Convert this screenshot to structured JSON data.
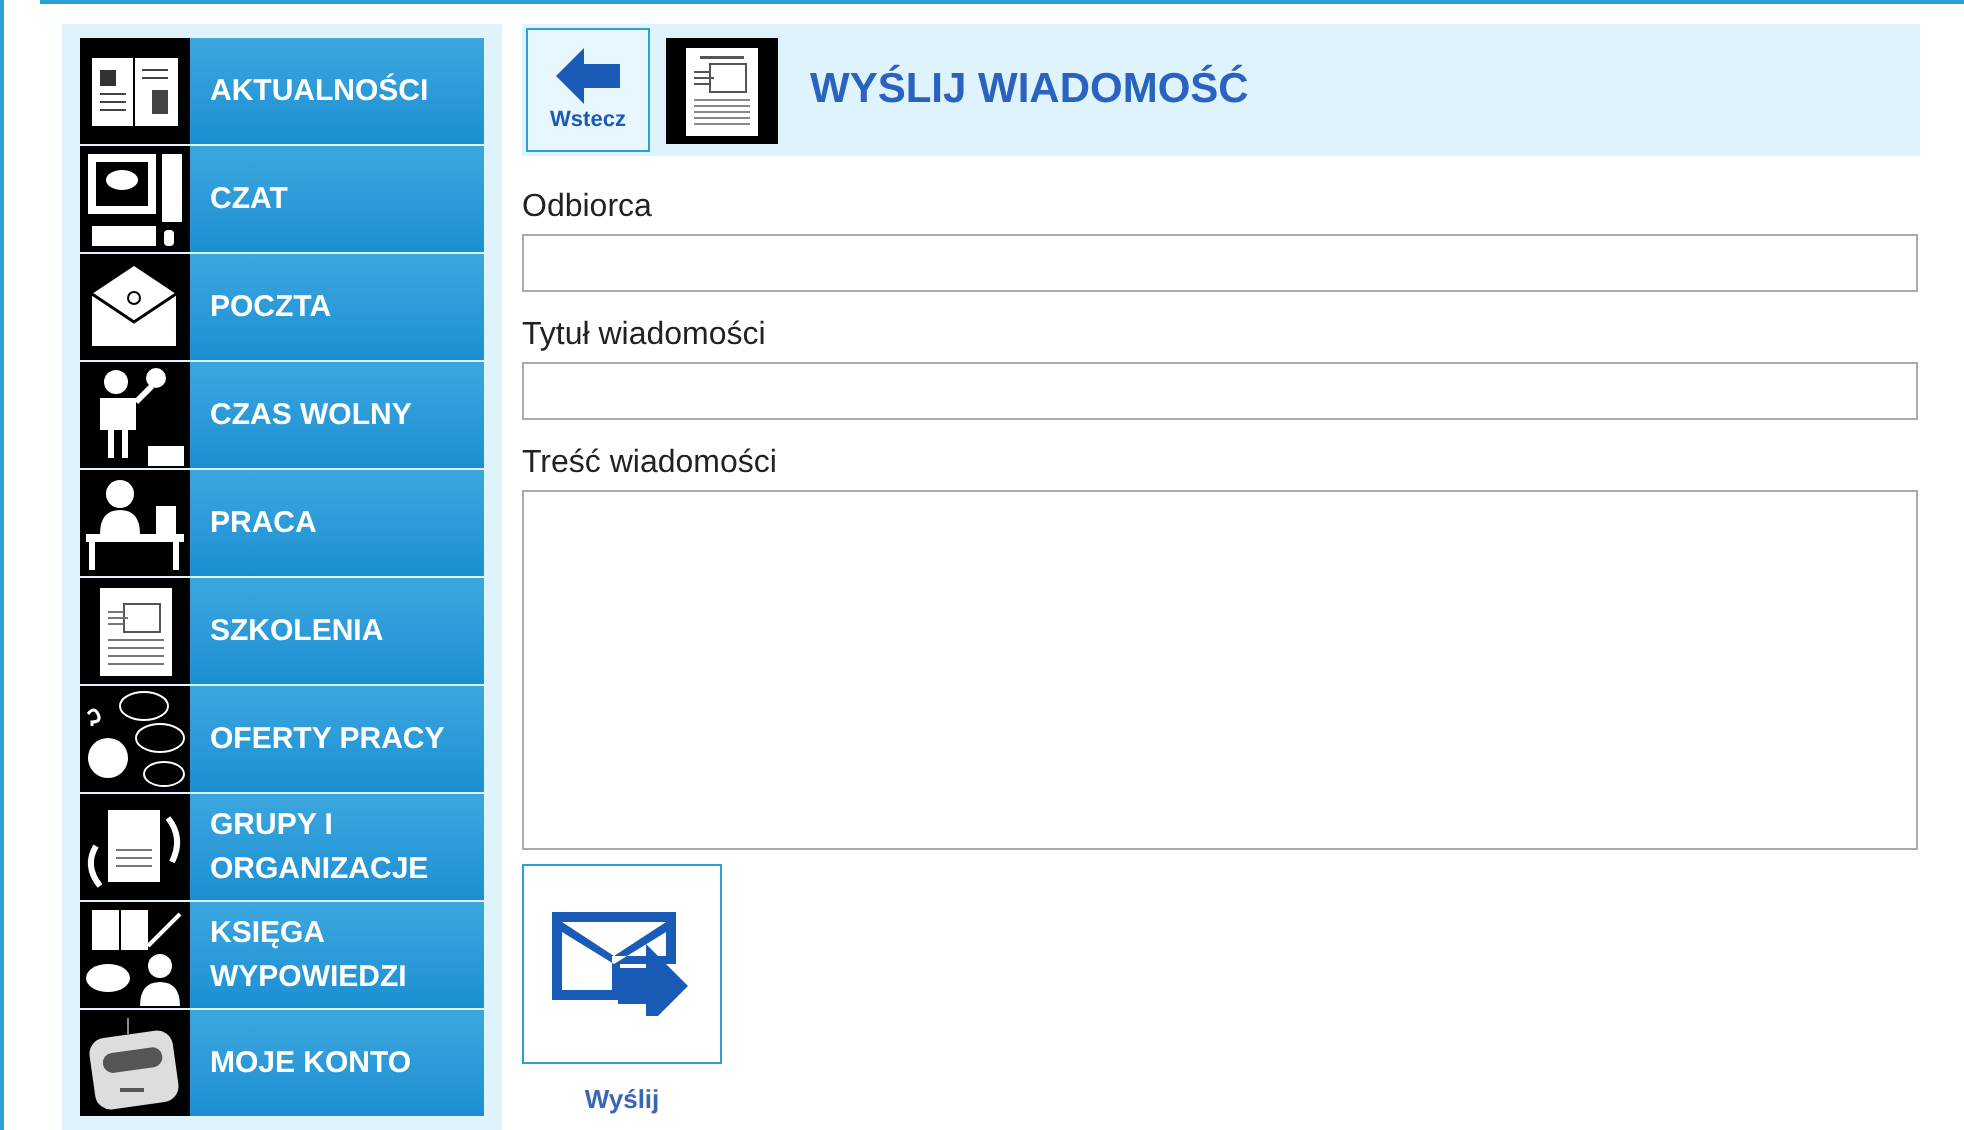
{
  "sidebar": {
    "items": [
      {
        "label": "AKTUALNOŚCI"
      },
      {
        "label": "CZAT"
      },
      {
        "label": "POCZTA"
      },
      {
        "label": "CZAS WOLNY"
      },
      {
        "label": "PRACA"
      },
      {
        "label": "SZKOLENIA"
      },
      {
        "label": "OFERTY PRACY"
      },
      {
        "label": "GRUPY I ORGANIZACJE"
      },
      {
        "label": "KSIĘGA WYPOWIEDZI"
      },
      {
        "label": "MOJE KONTO"
      }
    ]
  },
  "header": {
    "back_button": "Wstecz",
    "title": "WYŚLIJ WIADOMOŚĆ"
  },
  "form": {
    "fields": [
      {
        "label": "Odbiorca",
        "kind": "input"
      },
      {
        "label": "Tytuł wiadomości",
        "kind": "input"
      },
      {
        "label": "Treść wiadomości",
        "kind": "textarea"
      }
    ],
    "send_button": "Wyślij"
  }
}
